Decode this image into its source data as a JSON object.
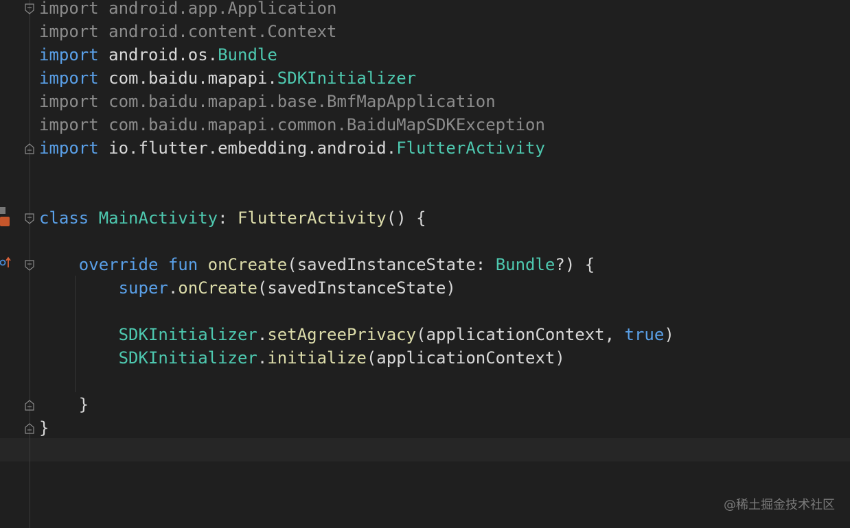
{
  "editor": {
    "lines": [
      {
        "tokens": [
          {
            "t": "import android.app.Application",
            "c": "dim"
          }
        ]
      },
      {
        "tokens": [
          {
            "t": "import android.content.Context",
            "c": "dim"
          }
        ]
      },
      {
        "tokens": [
          {
            "t": "import",
            "c": "kw"
          },
          {
            "t": " android.os.",
            "c": "pl"
          },
          {
            "t": "Bundle",
            "c": "cls"
          }
        ]
      },
      {
        "tokens": [
          {
            "t": "import",
            "c": "kw"
          },
          {
            "t": " com.baidu.mapapi.",
            "c": "pl"
          },
          {
            "t": "SDKInitializer",
            "c": "cls"
          }
        ]
      },
      {
        "tokens": [
          {
            "t": "import com.baidu.mapapi.base.BmfMapApplication",
            "c": "dim"
          }
        ]
      },
      {
        "tokens": [
          {
            "t": "import com.baidu.mapapi.common.BaiduMapSDKException",
            "c": "dim"
          }
        ]
      },
      {
        "tokens": [
          {
            "t": "import",
            "c": "kw"
          },
          {
            "t": " io.flutter.embedding.android.",
            "c": "pl"
          },
          {
            "t": "FlutterActivity",
            "c": "cls"
          }
        ]
      },
      {
        "tokens": []
      },
      {
        "tokens": []
      },
      {
        "tokens": [
          {
            "t": "class",
            "c": "kw"
          },
          {
            "t": " ",
            "c": "pl"
          },
          {
            "t": "MainActivity",
            "c": "cls"
          },
          {
            "t": ": ",
            "c": "pl"
          },
          {
            "t": "FlutterActivity",
            "c": "fn"
          },
          {
            "t": "() {",
            "c": "pl"
          }
        ]
      },
      {
        "tokens": []
      },
      {
        "tokens": [
          {
            "t": "    ",
            "c": "pl"
          },
          {
            "t": "override",
            "c": "kw"
          },
          {
            "t": " ",
            "c": "pl"
          },
          {
            "t": "fun",
            "c": "kw"
          },
          {
            "t": " ",
            "c": "pl"
          },
          {
            "t": "onCreate",
            "c": "fn"
          },
          {
            "t": "(savedInstanceState: ",
            "c": "pl"
          },
          {
            "t": "Bundle",
            "c": "cls"
          },
          {
            "t": "?) {",
            "c": "pl"
          }
        ]
      },
      {
        "tokens": [
          {
            "t": "        ",
            "c": "pl"
          },
          {
            "t": "super",
            "c": "kw"
          },
          {
            "t": ".",
            "c": "pl"
          },
          {
            "t": "onCreate",
            "c": "fn"
          },
          {
            "t": "(savedInstanceState)",
            "c": "pl"
          }
        ]
      },
      {
        "tokens": []
      },
      {
        "tokens": [
          {
            "t": "        ",
            "c": "pl"
          },
          {
            "t": "SDKInitializer",
            "c": "cls"
          },
          {
            "t": ".",
            "c": "pl"
          },
          {
            "t": "setAgreePrivacy",
            "c": "fn"
          },
          {
            "t": "(applicationContext, ",
            "c": "pl"
          },
          {
            "t": "true",
            "c": "kw"
          },
          {
            "t": ")",
            "c": "pl"
          }
        ]
      },
      {
        "tokens": [
          {
            "t": "        ",
            "c": "pl"
          },
          {
            "t": "SDKInitializer",
            "c": "cls"
          },
          {
            "t": ".",
            "c": "pl"
          },
          {
            "t": "initialize",
            "c": "fn"
          },
          {
            "t": "(applicationContext)",
            "c": "pl"
          }
        ]
      },
      {
        "tokens": []
      },
      {
        "tokens": [
          {
            "t": "    }",
            "c": "pl"
          }
        ]
      },
      {
        "tokens": [
          {
            "t": "}",
            "c": "pl"
          }
        ]
      },
      {
        "tokens": []
      }
    ]
  },
  "watermark": "@稀土掘金技术社区",
  "colors": {
    "background": "#1f1f1f",
    "keyword": "#5aa0e8",
    "class": "#4ec9b0",
    "function": "#dcdcaa",
    "unused_import": "#8c8c8c",
    "plain": "#d8d8d8"
  },
  "icons": [
    "fold-icon",
    "bookmark-icon",
    "run-gutter-icon",
    "override-gutter-icon"
  ]
}
